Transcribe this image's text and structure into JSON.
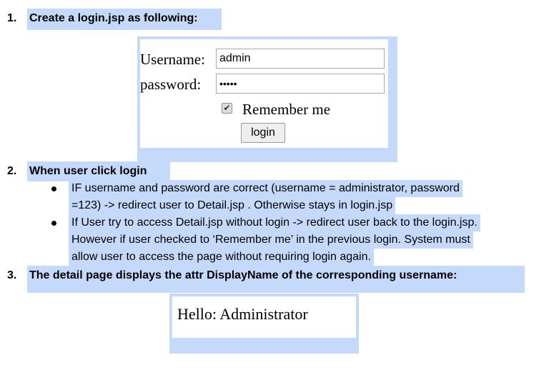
{
  "steps": [
    {
      "number": "1.",
      "heading": "Create a login.jsp as following:"
    },
    {
      "number": "2.",
      "heading": "When user click login"
    },
    {
      "number": "3.",
      "heading": "The detail page displays the attr DisplayName of the corresponding username:"
    }
  ],
  "login_form": {
    "username_label": "Username:",
    "username_value": "admin",
    "password_label": "password:",
    "password_value": "•••••",
    "remember_label": "Remember me",
    "remember_checked": true,
    "checkmark": "✔",
    "login_button": "login"
  },
  "bullets": [
    {
      "lines": [
        "IF username and password are correct (username = administrator, password",
        "=123) -> redirect user to Detail.jsp . Otherwise stays in login.jsp"
      ]
    },
    {
      "lines": [
        "If User try to access Detail.jsp without login -> redirect user back to the login.jsp.",
        "However if user checked to ‘Remember me’ in the previous login. System must",
        "allow user to access the page without requiring login again."
      ]
    }
  ],
  "detail_page": {
    "greeting": "Hello: Administrator"
  },
  "colors": {
    "highlight": "#c5d9fb"
  }
}
